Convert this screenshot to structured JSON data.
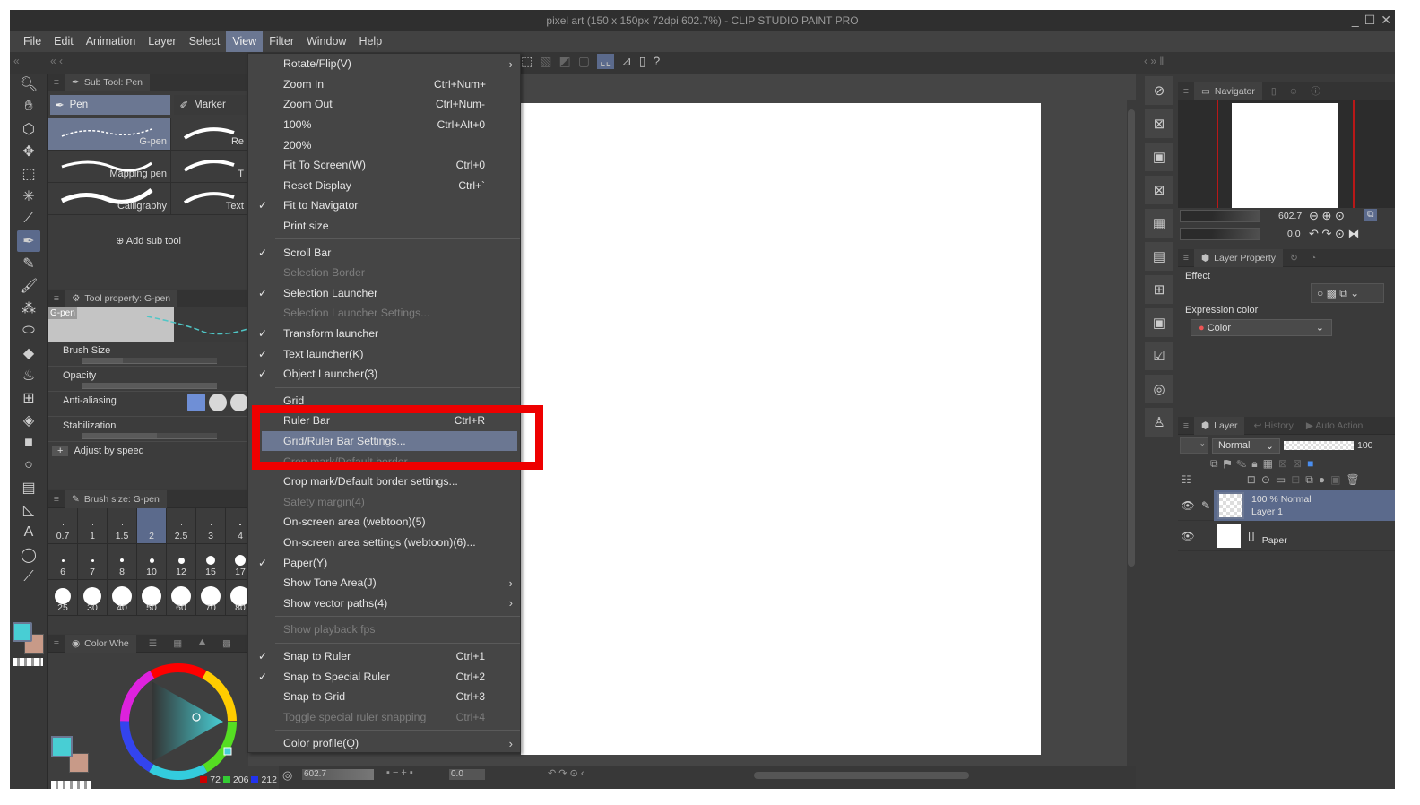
{
  "window": {
    "title": "pixel art (150 x 150px 72dpi 602.7%)  - CLIP STUDIO PAINT PRO",
    "minimize": "_",
    "maximize": "☐",
    "close": "✕"
  },
  "menubar": {
    "items": [
      {
        "label": "File"
      },
      {
        "label": "Edit"
      },
      {
        "label": "Animation"
      },
      {
        "label": "Layer"
      },
      {
        "label": "Select"
      },
      {
        "label": "View",
        "active": true
      },
      {
        "label": "Filter"
      },
      {
        "label": "Window"
      },
      {
        "label": "Help"
      }
    ]
  },
  "view_menu": {
    "items": [
      {
        "label": "Rotate/Flip(V)",
        "submenu": true
      },
      {
        "label": "Zoom In",
        "shortcut": "Ctrl+Num+"
      },
      {
        "label": "Zoom Out",
        "shortcut": "Ctrl+Num-"
      },
      {
        "label": "100%",
        "shortcut": "Ctrl+Alt+0"
      },
      {
        "label": "200%"
      },
      {
        "label": "Fit To Screen(W)",
        "shortcut": "Ctrl+0"
      },
      {
        "label": "Reset Display",
        "shortcut": "Ctrl+`"
      },
      {
        "label": "Fit to Navigator",
        "checked": true
      },
      {
        "label": "Print size"
      },
      {
        "label": "Scroll Bar",
        "checked": true
      },
      {
        "label": "Selection Border",
        "disabled": true
      },
      {
        "label": "Selection Launcher",
        "checked": true
      },
      {
        "label": "Selection Launcher Settings...",
        "disabled": true
      },
      {
        "label": "Transform launcher",
        "checked": true
      },
      {
        "label": "Text launcher(K)",
        "checked": true
      },
      {
        "label": "Object Launcher(3)",
        "checked": true
      },
      {
        "label": "Grid"
      },
      {
        "label": "Ruler Bar",
        "shortcut": "Ctrl+R"
      },
      {
        "label": "Grid/Ruler Bar Settings...",
        "highlighted": true
      },
      {
        "label": "Crop mark/Default border",
        "disabled": true
      },
      {
        "label": "Crop mark/Default border settings..."
      },
      {
        "label": "Safety margin(4)",
        "disabled": true
      },
      {
        "label": "On-screen area (webtoon)(5)"
      },
      {
        "label": "On-screen area settings (webtoon)(6)..."
      },
      {
        "label": "Paper(Y)",
        "checked": true
      },
      {
        "label": "Show Tone Area(J)",
        "submenu": true
      },
      {
        "label": "Show vector paths(4)",
        "submenu": true
      },
      {
        "label": "Show playback fps",
        "disabled": true
      },
      {
        "label": "Snap to Ruler",
        "checked": true,
        "shortcut": "Ctrl+1"
      },
      {
        "label": "Snap to Special Ruler",
        "checked": true,
        "shortcut": "Ctrl+2"
      },
      {
        "label": "Snap to Grid",
        "shortcut": "Ctrl+3"
      },
      {
        "label": "Toggle special ruler snapping",
        "disabled": true,
        "shortcut": "Ctrl+4"
      },
      {
        "label": "Color profile(Q)",
        "submenu": true
      }
    ],
    "check_glyph": "✓",
    "submenu_glyph": "›"
  },
  "subtool_panel": {
    "title": "Sub Tool: Pen",
    "categories": [
      "Pen",
      "Marker"
    ],
    "brushes": [
      {
        "label": "G-pen",
        "selected": true
      },
      {
        "label": "Re"
      },
      {
        "label": "Mapping pen"
      },
      {
        "label": "T"
      },
      {
        "label": "Calligraphy"
      },
      {
        "label": "Text"
      }
    ],
    "add_label": "Add sub tool"
  },
  "tool_property": {
    "title": "Tool property: G-pen",
    "preview_label": "G-pen",
    "brush_size_label": "Brush Size",
    "opacity_label": "Opacity",
    "antialias_label": "Anti-aliasing",
    "stabilization_label": "Stabilization",
    "adjust_label": "Adjust by speed",
    "brush_size_fill": 0.3,
    "opacity_fill": 1.0,
    "stabilization_fill": 0.55
  },
  "brush_size_panel": {
    "title": "Brush size: G-pen",
    "sizes": [
      "0.7",
      "1",
      "1.5",
      "2",
      "2.5",
      "3",
      "4",
      "6",
      "7",
      "8",
      "10",
      "12",
      "15",
      "17",
      "25",
      "30",
      "40",
      "50",
      "60",
      "70",
      "80"
    ],
    "selected": "2"
  },
  "color_panel": {
    "title": "Color Whe",
    "main_color": "#48ced4",
    "sub_color": "#c89a88",
    "r": "72",
    "g": "206",
    "b": "212"
  },
  "bottom_bar": {
    "zoom": "602.7",
    "rotation": "0.0"
  },
  "navigator": {
    "title": "Navigator",
    "zoom": "602.7",
    "rotation": "0.0"
  },
  "layer_property": {
    "title": "Layer Property",
    "effect_label": "Effect",
    "expression_label": "Expression color",
    "expression_value": "Color"
  },
  "layer_panel": {
    "tabs": [
      "Layer",
      "History",
      "Auto Action"
    ],
    "blend_mode": "Normal",
    "opacity": "100",
    "layers": [
      {
        "info": "100 % Normal",
        "name": "Layer 1",
        "selected": true
      },
      {
        "info": "",
        "name": "Paper",
        "selected": false
      }
    ]
  }
}
